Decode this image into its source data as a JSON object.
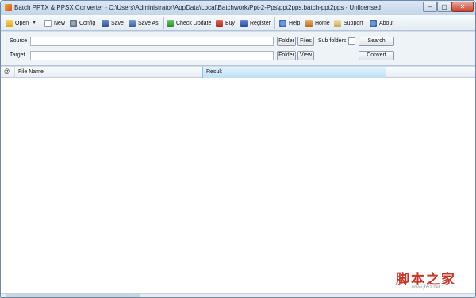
{
  "window": {
    "title": "Batch PPTX & PPSX Converter - C:\\Users\\Administrator\\AppData\\Local\\Batchwork\\Ppt-2-Pps\\ppt2pps.batch-ppt2pps - Unlicensed",
    "controls": {
      "minimize": "‒",
      "maximize": "▢",
      "close": "✕"
    }
  },
  "toolbar": {
    "open": "Open",
    "new": "New",
    "config": "Config",
    "save": "Save",
    "save_as": "Save As",
    "check_update": "Check Update",
    "buy": "Buy",
    "register": "Register",
    "help": "Help",
    "home": "Home",
    "support": "Support",
    "about": "About",
    "dropdown_arrow": "▼"
  },
  "form": {
    "source_label": "Source",
    "source_value": "",
    "target_label": "Target",
    "target_value": "",
    "folder_button": "Folder",
    "files_button": "Files",
    "view_button": "View",
    "subfolders_label": "Sub folders",
    "search_button": "Search",
    "convert_button": "Convert"
  },
  "grid": {
    "columns": [
      "@",
      "File Name",
      "Result"
    ],
    "rows": []
  },
  "watermark": {
    "text": "脚本之家",
    "url": "www.jb51.net"
  }
}
